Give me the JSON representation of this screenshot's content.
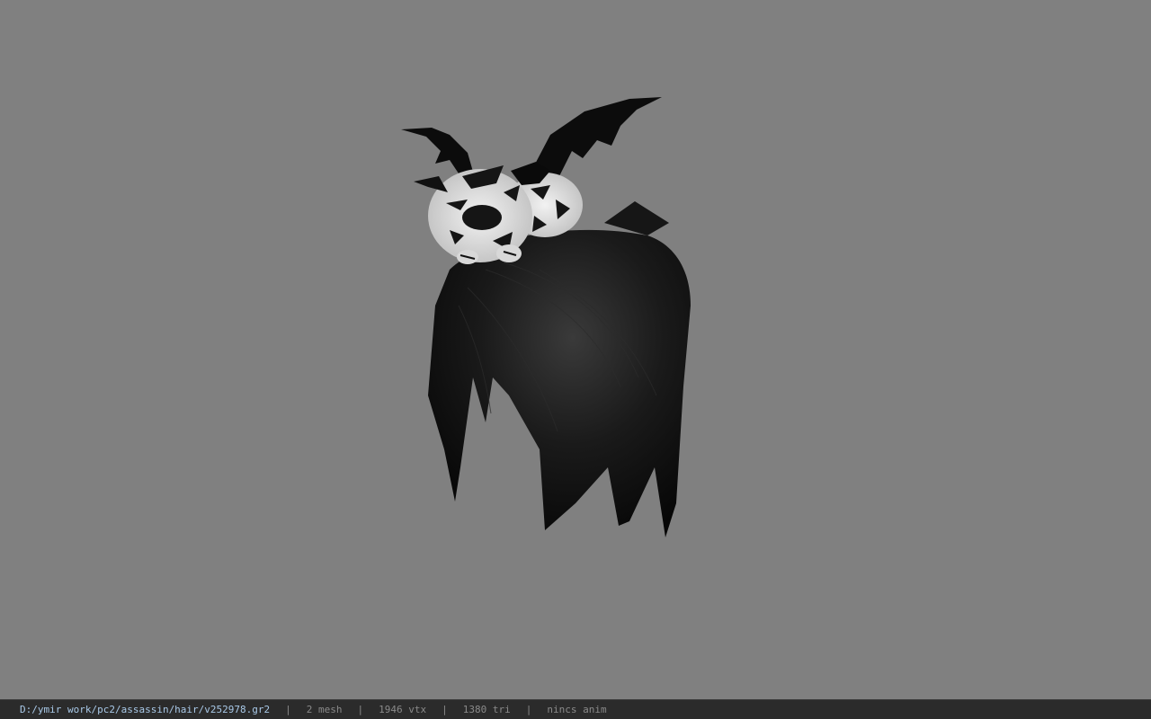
{
  "viewer": {
    "background_color": "#808080",
    "model": {
      "description_icon": "hair-model-icon",
      "primary_color": "#101010",
      "accent_color": "#e8e8e8"
    }
  },
  "status_bar": {
    "file_path": "D:/ymir work/pc2/assassin/hair/v252978.gr2",
    "separator": "|",
    "mesh": "2 mesh",
    "vertices": "1946 vtx",
    "triangles": "1380 tri",
    "anim": "nincs anim"
  }
}
